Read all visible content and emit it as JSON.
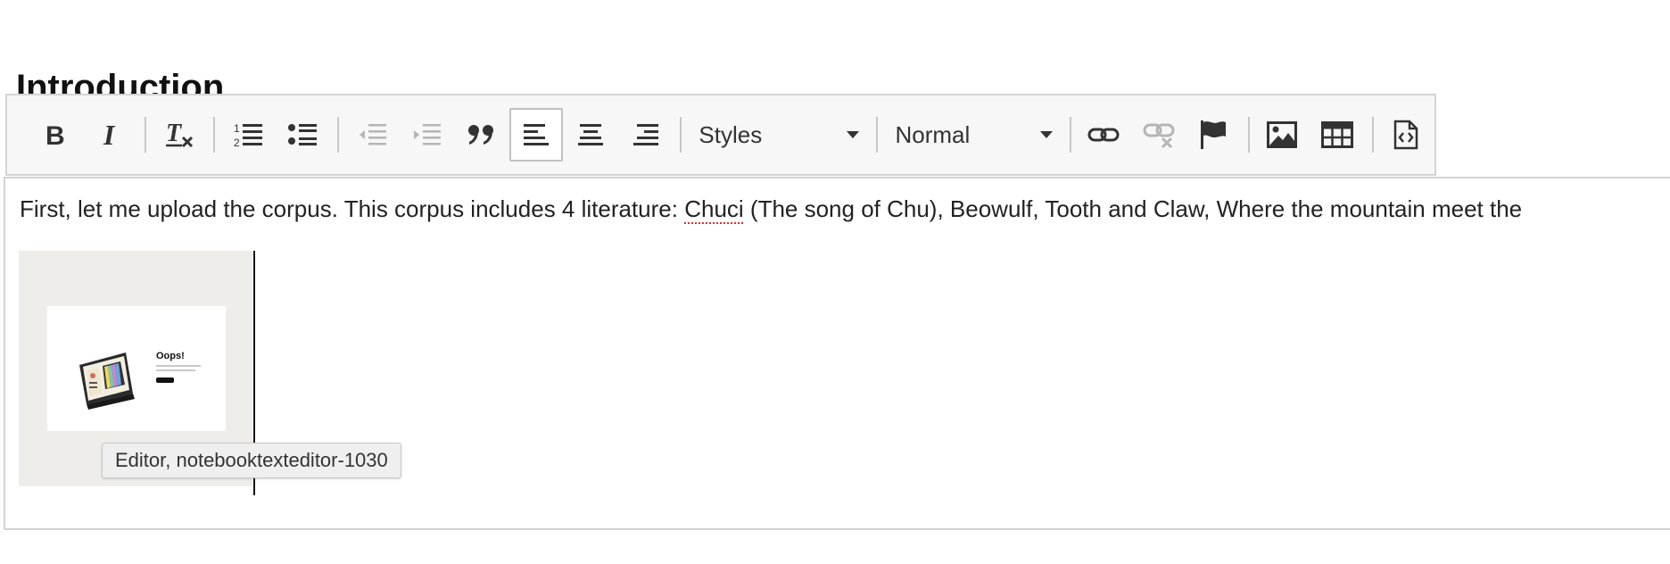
{
  "heading": "Introduction",
  "toolbar": {
    "styles_label": "Styles",
    "format_label": "Normal"
  },
  "editor": {
    "paragraph_before": "First, let me upload the corpus. This corpus includes 4 literature: ",
    "misspelled_word": "Chuci",
    "paragraph_after": " (The song of Chu), Beowulf, Tooth and Claw, Where the mountain meet the"
  },
  "image": {
    "title": "Oops!"
  },
  "tooltip": "Editor, notebooktexteditor-1030",
  "colors": {
    "toolbar_bg": "#f7f7f7",
    "border": "#d4d4d4",
    "icon": "#333333",
    "icon_disabled": "#b5b5b5",
    "spell_underline": "#e03030"
  }
}
